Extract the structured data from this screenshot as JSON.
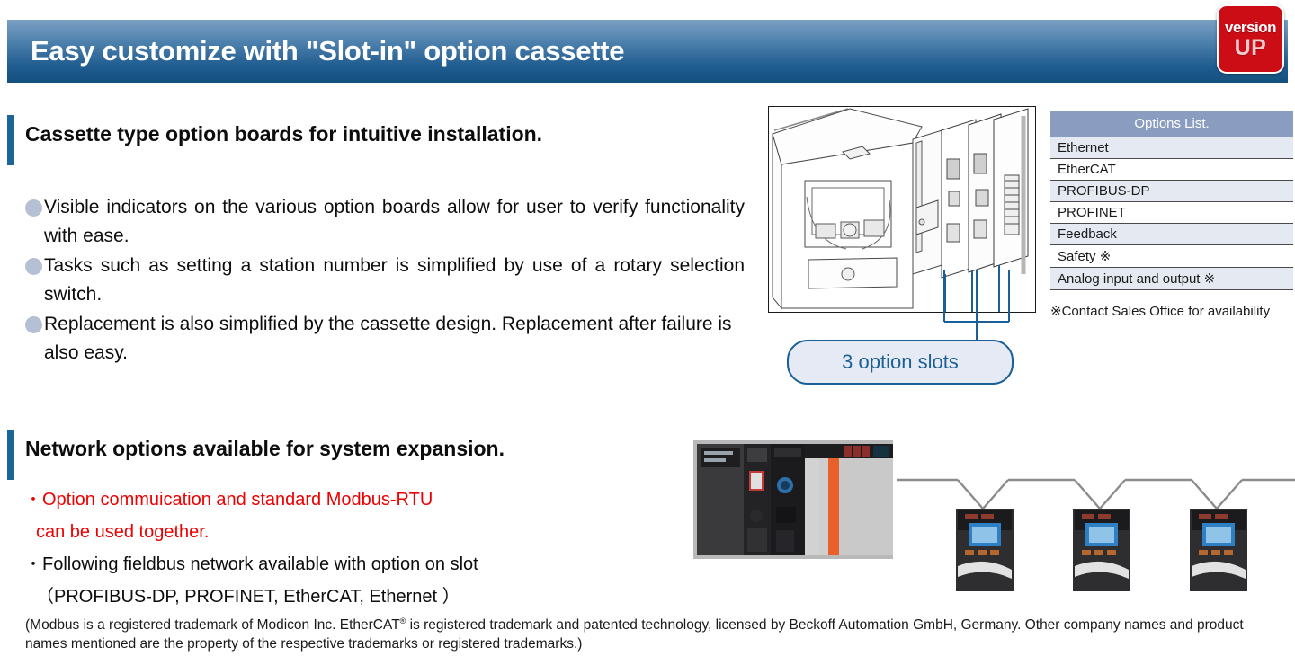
{
  "banner": {
    "title": "Easy customize with \"Slot-in\" option cassette"
  },
  "badge": {
    "line1": "version",
    "line2": "UP"
  },
  "section1": {
    "heading": "Cassette type option boards for intuitive installation.",
    "bullets": [
      "Visible indicators on the various option boards allow for user to verify functionality with ease.",
      "Tasks such as setting a station number is simplified by use of a rotary selection switch.",
      "Replacement is also simplified by the cassette design. Replacement after failure is also easy."
    ],
    "callout": "3 option slots"
  },
  "options_list": {
    "header": "Options List.",
    "rows": [
      "Ethernet",
      "EtherCAT",
      "PROFIBUS-DP",
      "PROFINET",
      "Feedback",
      "Safety ※",
      "Analog input and output ※"
    ],
    "note": "※Contact Sales Office for availability"
  },
  "section2": {
    "heading": "Network options available for system expansion.",
    "lines": [
      {
        "text": "Option commuication and standard Modbus-RTU",
        "bullet": true,
        "color": "red"
      },
      {
        "text": "can be used together.",
        "bullet": false,
        "color": "red"
      },
      {
        "text": "Following fieldbus network available with option on slot",
        "bullet": true,
        "color": "black"
      },
      {
        "text": "（PROFIBUS-DP, PROFINET, EtherCAT, Ethernet ）",
        "bullet": false,
        "color": "black"
      }
    ]
  },
  "footnote": {
    "part1": "(Modbus is a registered trademark of Modicon Inc. EtherCAT",
    "sup": "®",
    "part2": " is registered trademark and patented technology, licensed by Beckoff Automation GmbH, Germany. Other company names and product names mentioned are the property of the respective trademarks or registered trademarks.)"
  },
  "colors": {
    "banner_top": "#7ba0c4",
    "banner_bottom": "#14517f",
    "accent_bar": "#1a6699",
    "badge_red": "#cc0d16",
    "table_header": "#8a9dc0",
    "table_row_tint": "#e4e9f2",
    "callout_border": "#1a5f96",
    "callout_fill": "#e6eaf4",
    "red_text": "#ee0000",
    "bullet_dot": "#b5c0d4"
  }
}
